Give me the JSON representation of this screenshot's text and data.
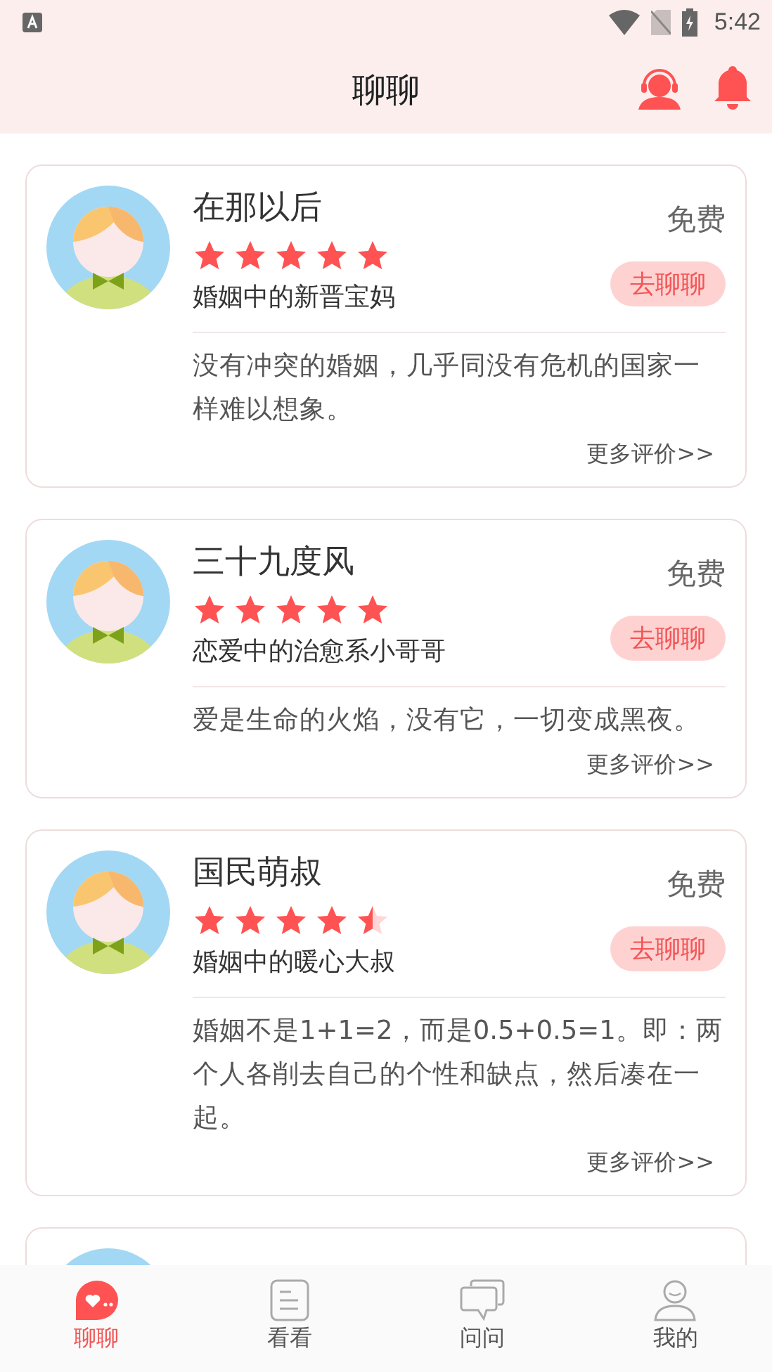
{
  "status_bar": {
    "time": "5:42"
  },
  "header": {
    "title": "聊聊"
  },
  "cards": [
    {
      "kind": "full",
      "name": "在那以后",
      "stars": 5,
      "subtitle": "婚姻中的新晋宝妈",
      "price": "免费",
      "action": "去聊聊",
      "quote": "没有冲突的婚姻，几乎同没有危机的国家一样难以想象。",
      "more": "更多评价>>"
    },
    {
      "kind": "full",
      "name": "三十九度风",
      "stars": 5,
      "subtitle": "恋爱中的治愈系小哥哥",
      "price": "免费",
      "action": "去聊聊",
      "quote": "爱是生命的火焰，没有它，一切变成黑夜。",
      "more": "更多评价>>"
    },
    {
      "kind": "full",
      "name": "国民萌叔",
      "stars": 4.5,
      "subtitle": "婚姻中的暖心大叔",
      "price": "免费",
      "action": "去聊聊",
      "quote": "婚姻不是1+1=2，而是0.5+0.5=1。即：两个人各削去自己的个性和缺点，然后凑在一起。",
      "more": "更多评价>>"
    },
    {
      "kind": "cut_off"
    }
  ],
  "nav": [
    {
      "label": "聊聊",
      "kind": "chat",
      "selected": true
    },
    {
      "label": "看看",
      "kind": "doc",
      "selected": false
    },
    {
      "label": "问问",
      "kind": "ask",
      "selected": false
    },
    {
      "label": "我的",
      "kind": "me",
      "selected": false
    }
  ]
}
